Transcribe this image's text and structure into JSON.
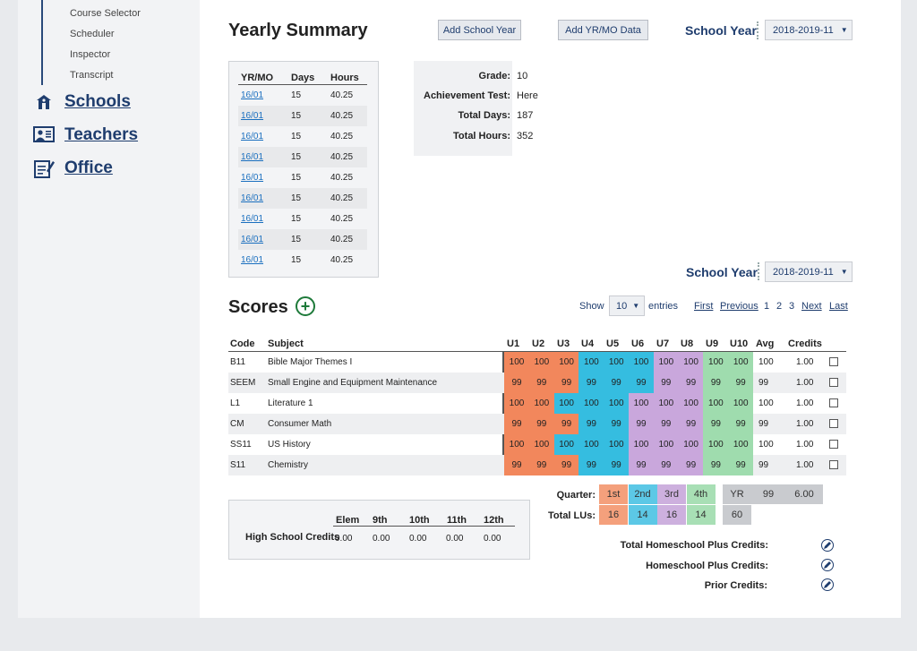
{
  "sidebar": {
    "sub_items": [
      "Course Selector",
      "Scheduler",
      "Inspector",
      "Transcript"
    ],
    "nav": [
      {
        "label": "Schools",
        "icon": "school-icon"
      },
      {
        "label": "Teachers",
        "icon": "teacher-icon"
      },
      {
        "label": "Office",
        "icon": "office-icon"
      }
    ]
  },
  "header": {
    "title": "Yearly Summary",
    "add_school_year": "Add School Year",
    "add_yrmo": "Add YR/MO Data",
    "school_year_label": "School Year",
    "school_year_value": "2018-2019-11"
  },
  "yrmo_table": {
    "headers": [
      "YR/MO",
      "Days",
      "Hours"
    ],
    "rows": [
      [
        "16/01",
        "15",
        "40.25"
      ],
      [
        "16/01",
        "15",
        "40.25"
      ],
      [
        "16/01",
        "15",
        "40.25"
      ],
      [
        "16/01",
        "15",
        "40.25"
      ],
      [
        "16/01",
        "15",
        "40.25"
      ],
      [
        "16/01",
        "15",
        "40.25"
      ],
      [
        "16/01",
        "15",
        "40.25"
      ],
      [
        "16/01",
        "15",
        "40.25"
      ],
      [
        "16/01",
        "15",
        "40.25"
      ]
    ]
  },
  "info": [
    {
      "label": "Grade:",
      "value": "10"
    },
    {
      "label": "Achievement Test:",
      "value": "Here"
    },
    {
      "label": "Total Days:",
      "value": "187"
    },
    {
      "label": "Total Hours:",
      "value": "352"
    }
  ],
  "scores": {
    "title": "Scores",
    "school_year_label": "School Year",
    "school_year_value": "2018-2019-11",
    "show_label": "Show",
    "entries_value": "10",
    "entries_label": "entries",
    "pager": [
      "First",
      "Previous",
      "1",
      "2",
      "3",
      "Next",
      "Last"
    ],
    "headers": [
      "Code",
      "Subject",
      "U1",
      "U2",
      "U3",
      "U4",
      "U5",
      "U6",
      "U7",
      "U8",
      "U9",
      "U10",
      "Avg",
      "Credits"
    ],
    "rows": [
      {
        "code": "B11",
        "subject": "Bible Major Themes I",
        "units": [
          "100",
          "100",
          "100",
          "100",
          "100",
          "100",
          "100",
          "100",
          "100",
          "100"
        ],
        "colors": [
          "o",
          "o",
          "o",
          "b",
          "b",
          "b",
          "p",
          "p",
          "g",
          "g"
        ],
        "avg": "100",
        "credits": "1.00"
      },
      {
        "code": "SEEM",
        "subject": "Small Engine and Equipment Maintenance",
        "units": [
          "99",
          "99",
          "99",
          "99",
          "99",
          "99",
          "99",
          "99",
          "99",
          "99"
        ],
        "colors": [
          "o",
          "o",
          "o",
          "b",
          "b",
          "b",
          "p",
          "p",
          "g",
          "g"
        ],
        "avg": "99",
        "credits": "1.00"
      },
      {
        "code": "L1",
        "subject": "Literature 1",
        "units": [
          "100",
          "100",
          "100",
          "100",
          "100",
          "100",
          "100",
          "100",
          "100",
          "100"
        ],
        "colors": [
          "o",
          "o",
          "b",
          "b",
          "b",
          "p",
          "p",
          "p",
          "g",
          "g"
        ],
        "avg": "100",
        "credits": "1.00"
      },
      {
        "code": "CM",
        "subject": "Consumer Math",
        "units": [
          "99",
          "99",
          "99",
          "99",
          "99",
          "99",
          "99",
          "99",
          "99",
          "99"
        ],
        "colors": [
          "o",
          "o",
          "o",
          "b",
          "b",
          "p",
          "p",
          "p",
          "g",
          "g"
        ],
        "avg": "99",
        "credits": "1.00"
      },
      {
        "code": "SS11",
        "subject": "US History",
        "units": [
          "100",
          "100",
          "100",
          "100",
          "100",
          "100",
          "100",
          "100",
          "100",
          "100"
        ],
        "colors": [
          "o",
          "o",
          "b",
          "b",
          "b",
          "p",
          "p",
          "p",
          "g",
          "g"
        ],
        "avg": "100",
        "credits": "1.00"
      },
      {
        "code": "S11",
        "subject": "Chemistry",
        "units": [
          "99",
          "99",
          "99",
          "99",
          "99",
          "99",
          "99",
          "99",
          "99",
          "99"
        ],
        "colors": [
          "o",
          "o",
          "o",
          "b",
          "b",
          "p",
          "p",
          "p",
          "g",
          "g"
        ],
        "avg": "99",
        "credits": "1.00"
      }
    ],
    "colors": {
      "o": "#f2875c",
      "b": "#35bde0",
      "p": "#c9a7dc",
      "g": "#9fdcae"
    }
  },
  "quarters": {
    "quarter_label": "Quarter:",
    "total_label": "Total LUs:",
    "cols": [
      {
        "q": "1st",
        "lus": "16",
        "color": "#f4a07c"
      },
      {
        "q": "2nd",
        "lus": "14",
        "color": "#5cc8e6"
      },
      {
        "q": "3rd",
        "lus": "16",
        "color": "#cdb0de"
      },
      {
        "q": "4th",
        "lus": "14",
        "color": "#a8dfb5"
      }
    ],
    "yr_label": "YR",
    "yr_avg": "99",
    "yr_credits": "6.00",
    "yr_lus": "60"
  },
  "credits_box": {
    "headers": [
      "Elem",
      "9th",
      "10th",
      "11th",
      "12th"
    ],
    "row_label": "High School Credits",
    "values": [
      "0.00",
      "0.00",
      "0.00",
      "0.00",
      "0.00"
    ]
  },
  "homeschool": [
    "Total Homeschool Plus Credits:",
    "Homeschool Plus Credits:",
    "Prior Credits:"
  ]
}
